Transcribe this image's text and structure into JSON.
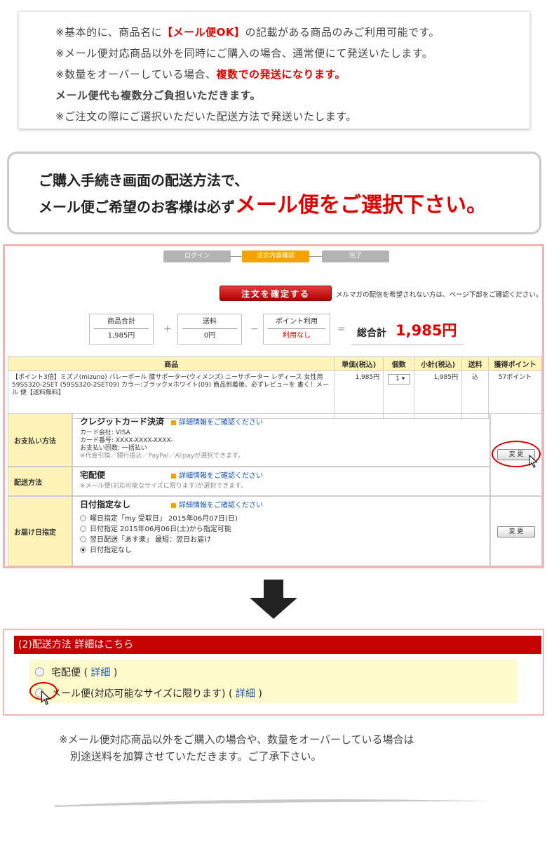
{
  "notice": {
    "line1_a": "※基本的に、商品名に",
    "line1_b": "【メール便OK】",
    "line1_c": "の記載がある商品のみご利用可能です。",
    "line2": "※メール便対応商品以外を同時にご購入の場合、通常便にて発送いたします。",
    "line3_a": "※数量をオーバーしている場合、",
    "line3_b": "複数での発送になります。",
    "line4": "メール便代も複数分ご負担いただきます。",
    "line5": "※ご注文の際にご選択いただいた配送方法で発送いたします。"
  },
  "callout": {
    "line1": "ご購入手続き画面の配送方法で、",
    "line2_a": "メール便ご希望のお客様は必ず",
    "line2_b": "メール便をご選択下さい。"
  },
  "checkout": {
    "steps": [
      "ログイン",
      "注文内容確認",
      "完了"
    ],
    "confirm_button": "注文を確定する",
    "mailmag_note": "メルマガの配信を希望されない方は、ページ下部をご確認ください。",
    "summary": {
      "subtotal_label": "商品合計",
      "subtotal_value": "1,985円",
      "plus": "+",
      "shipping_label": "送料",
      "shipping_value": "0円",
      "minus": "−",
      "points_label": "ポイント利用",
      "points_value": "利用なし",
      "equals": "=",
      "total_label": "総合計",
      "total_value": "1,985円"
    },
    "table": {
      "headers": [
        "商品",
        "単価(税込)",
        "個数",
        "小計(税込)",
        "送料",
        "獲得ポイント"
      ],
      "row": {
        "product": "【ポイント3倍】ミズノ(mizuno) バレーボール 膝サポーター(ウィメンズ) ニーサポーター レディース 女性用 59SS320-2SET (59SS320-2SET09) カラー:ブラック×ホワイト(09) 商品到着後、必ずレビューを 書く！メール 便【送料無料】",
        "unit_price": "1,985円",
        "quantity": "1",
        "subtotal": "1,985円",
        "shipping": "込",
        "points": "57ポイント"
      }
    },
    "payment": {
      "label": "お支払い方法",
      "method": "クレジットカード決済",
      "detail_link": "詳細情報をご確認ください",
      "card_company": "カード会社: VISA",
      "card_number": "カード番号: XXXX-XXXX-XXXX-",
      "installments": "お支払い回数: 一括払い",
      "note": "※代金引換／銀行振込／PayPal／Alipayが選択できます。",
      "change_button": "変 更"
    },
    "delivery": {
      "label": "配送方法",
      "method": "宅配便",
      "detail_link": "詳細情報をご確認ください",
      "note": "※メール便(対応可能なサイズに限ります)が選択できます。"
    },
    "date": {
      "label": "お届け日指定",
      "method": "日付指定なし",
      "detail_link": "詳細情報をご確認ください",
      "options": [
        "曜日指定「my 受取日」 2015年06月07日(日)",
        "日付指定  2015年06月06日(土)から指定可能",
        "翌日配送「あす楽」 最短：翌日お届け",
        "日付指定なし"
      ],
      "change_button": "変 更"
    }
  },
  "shipping_panel": {
    "header": "(2)配送方法  詳細はこちら",
    "option1_label": "宅配便",
    "option1_link": "詳細",
    "option2_label": "メール便(対応可能なサイズに限ります)",
    "option2_link": "詳細"
  },
  "footnote": {
    "line1": "※メール便対応商品以外をご購入の場合や、数量をオーバーしている場合は",
    "line2": "別途送料を加算させていただきます。ご了承下さい。"
  }
}
